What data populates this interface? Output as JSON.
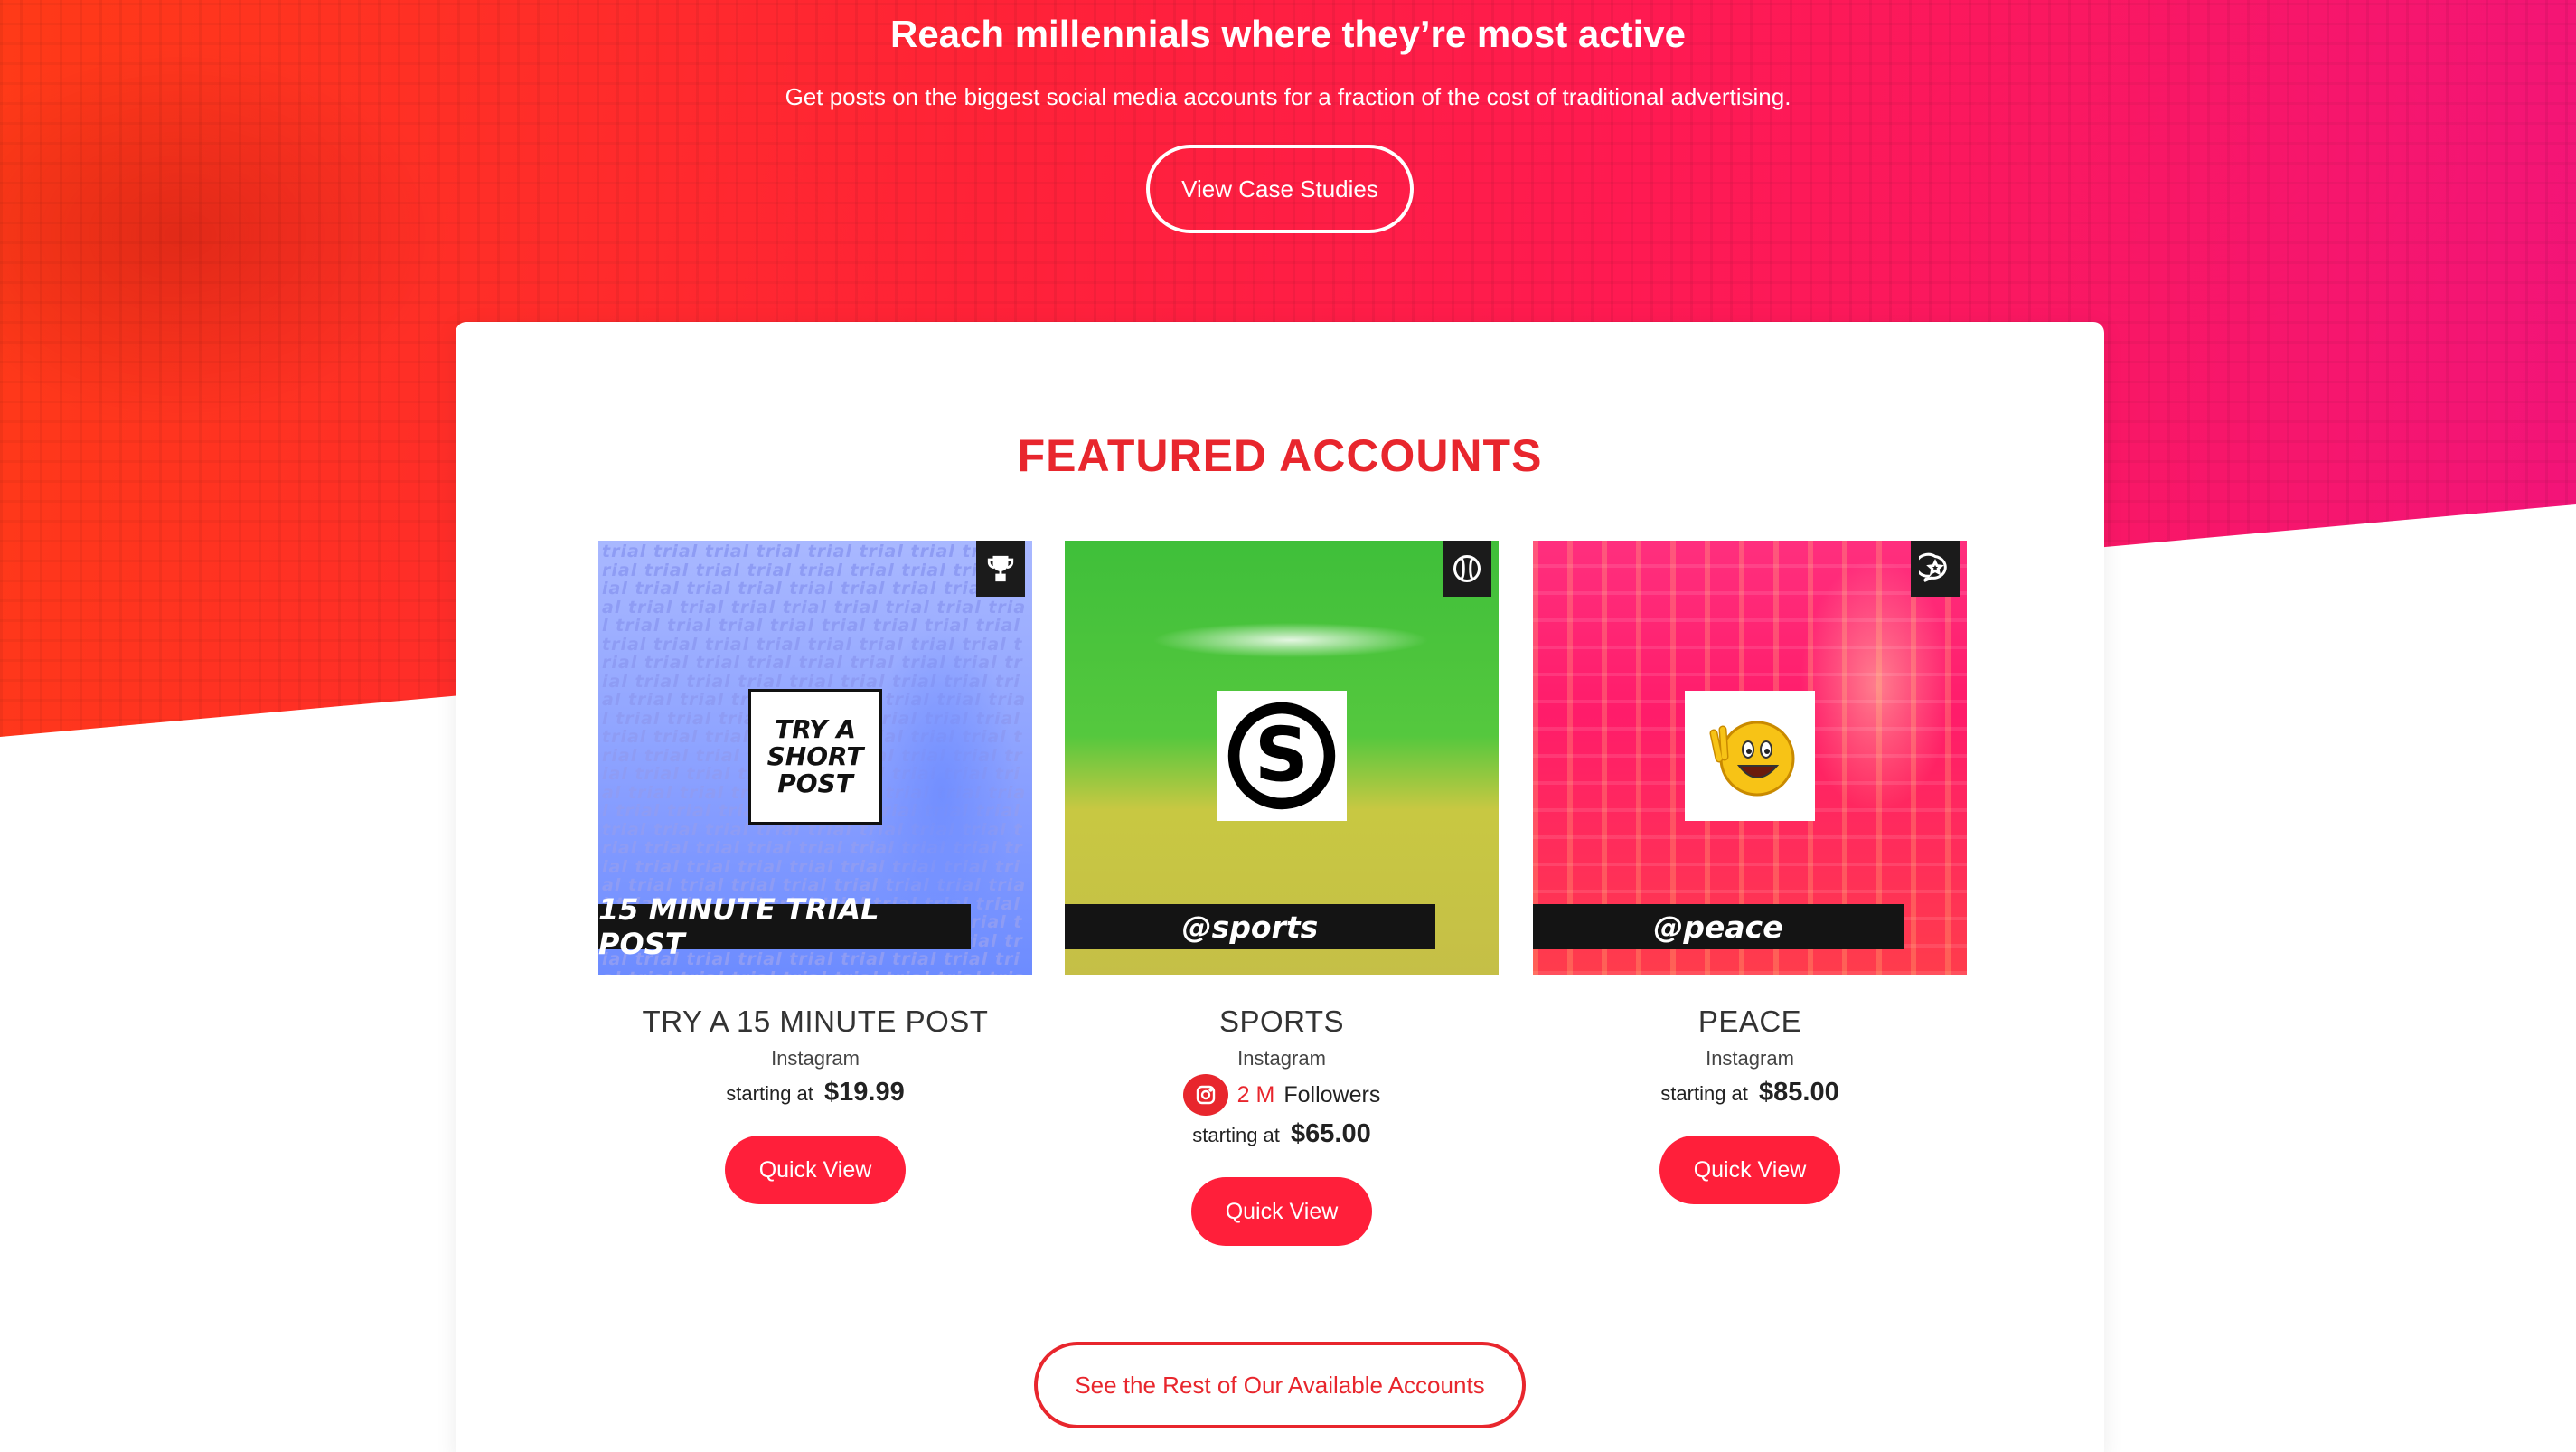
{
  "hero": {
    "title": "Reach millennials where they’re most active",
    "subtitle": "Get posts on the biggest social media accounts for a fraction of the cost of traditional advertising.",
    "cta_label": "View Case Studies"
  },
  "featured": {
    "title": "FEATURED ACCOUNTS",
    "cards": [
      {
        "name": "TRY A 15 MINUTE POST",
        "platform": "Instagram",
        "starting_label": "starting at",
        "price": "$19.99",
        "badge_icon": "trophy-icon",
        "thumb_box_text": "TRY A SHORT POST",
        "thumb_pattern_word": "trial",
        "thumb_bar_text": "15 MINUTE TRIAL POST",
        "button_label": "Quick View"
      },
      {
        "name": "SPORTS",
        "platform": "Instagram",
        "followers_count": "2 M",
        "followers_label": "Followers",
        "starting_label": "starting at",
        "price": "$65.00",
        "badge_icon": "baseball-icon",
        "thumb_logo_letter": "S",
        "thumb_bar_text": "@sports",
        "button_label": "Quick View"
      },
      {
        "name": "PEACE",
        "platform": "Instagram",
        "starting_label": "starting at",
        "price": "$85.00",
        "badge_icon": "chat-star-icon",
        "thumb_logo_icon": "peace-emoji-icon",
        "thumb_bar_text": "@peace",
        "button_label": "Quick View"
      }
    ],
    "rest_cta_label": "See the Rest of Our Available Accounts"
  },
  "colors": {
    "accent": "#e8262d",
    "button": "#ff1f3a",
    "hero_gradient_start": "#ff3a17",
    "hero_gradient_end": "#f2147a"
  }
}
